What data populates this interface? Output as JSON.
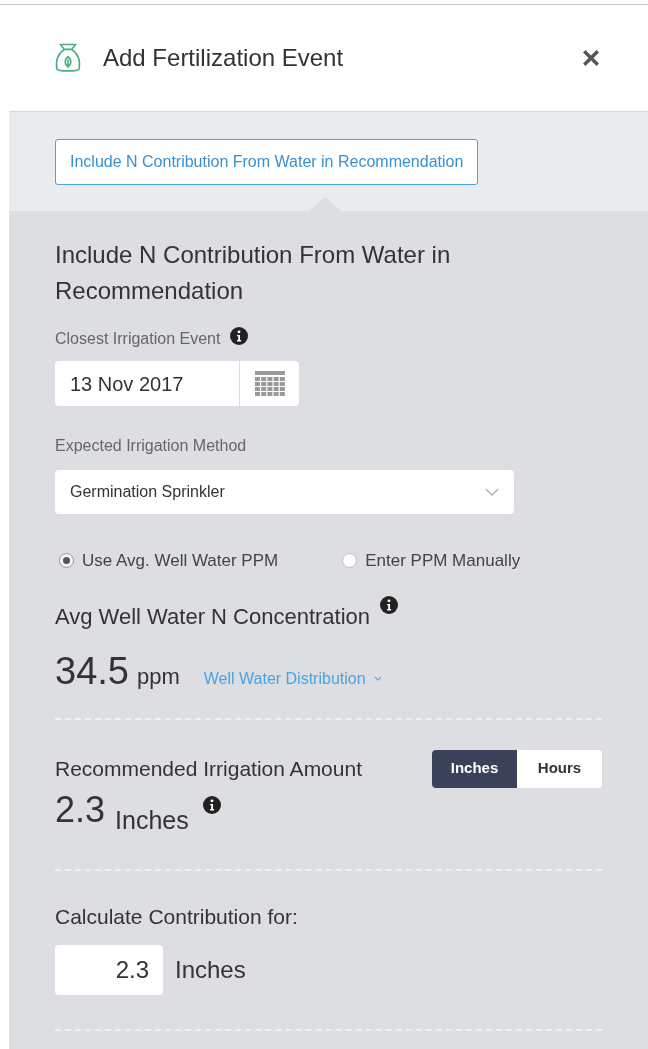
{
  "header": {
    "title": "Add Fertilization Event"
  },
  "include_button": {
    "label": "Include N Contribution From Water in Recommendation"
  },
  "section_title": "Include N Contribution From Water in Recommendation",
  "irrigation_event": {
    "label": "Closest Irrigation Event",
    "date": "13 Nov 2017"
  },
  "method": {
    "label": "Expected Irrigation Method",
    "value": "Germination Sprinkler"
  },
  "ppm_source": [
    {
      "label": "Use Avg. Well Water PPM",
      "selected": true
    },
    {
      "label": "Enter PPM Manually",
      "selected": false
    }
  ],
  "concentration": {
    "label": "Avg Well Water N Concentration",
    "value": "34.5",
    "unit": "ppm",
    "link": "Well Water Distribution"
  },
  "recommended": {
    "label": "Recommended Irrigation Amount",
    "value": "2.3",
    "unit": "Inches",
    "units": [
      {
        "label": "Inches",
        "selected": true
      },
      {
        "label": "Hours",
        "selected": false
      }
    ]
  },
  "calculate": {
    "label": "Calculate Contribution for:",
    "value": "2.3",
    "unit": "Inches"
  }
}
